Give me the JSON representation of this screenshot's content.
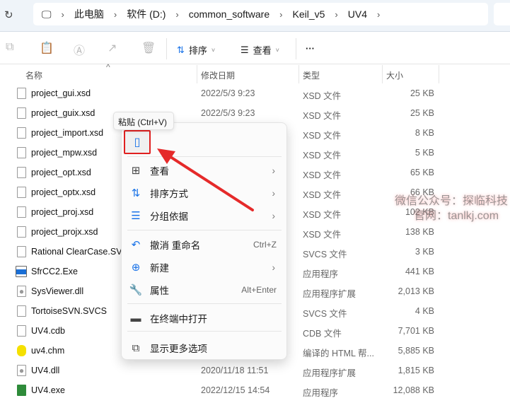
{
  "address": {
    "crumbs": [
      "此电脑",
      "软件 (D:)",
      "common_software",
      "Keil_v5",
      "UV4"
    ]
  },
  "toolbar": {
    "sort": "排序",
    "view": "查看",
    "more": "···"
  },
  "columns": [
    "名称",
    "修改日期",
    "类型",
    "大小"
  ],
  "files": [
    {
      "name": "project_gui.xsd",
      "date": "2022/5/3 9:23",
      "type": "XSD 文件",
      "size": "25 KB",
      "icon": "file"
    },
    {
      "name": "project_guix.xsd",
      "date": "2022/5/3 9:23",
      "type": "XSD 文件",
      "size": "25 KB",
      "icon": "file"
    },
    {
      "name": "project_import.xsd",
      "date": "",
      "type": "XSD 文件",
      "size": "8 KB",
      "icon": "file"
    },
    {
      "name": "project_mpw.xsd",
      "date": "",
      "type": "XSD 文件",
      "size": "5 KB",
      "icon": "file"
    },
    {
      "name": "project_opt.xsd",
      "date": "",
      "type": "XSD 文件",
      "size": "65 KB",
      "icon": "file"
    },
    {
      "name": "project_optx.xsd",
      "date": "",
      "type": "XSD 文件",
      "size": "66 KB",
      "icon": "file"
    },
    {
      "name": "project_proj.xsd",
      "date": "",
      "type": "XSD 文件",
      "size": "102 KB",
      "icon": "file"
    },
    {
      "name": "project_projx.xsd",
      "date": "",
      "type": "XSD 文件",
      "size": "138 KB",
      "icon": "file"
    },
    {
      "name": "Rational ClearCase.SV",
      "date": "",
      "type": "SVCS 文件",
      "size": "3 KB",
      "icon": "file"
    },
    {
      "name": "SfrCC2.Exe",
      "date": "",
      "type": "应用程序",
      "size": "441 KB",
      "icon": "exe"
    },
    {
      "name": "SysViewer.dll",
      "date": "",
      "type": "应用程序扩展",
      "size": "2,013 KB",
      "icon": "dll"
    },
    {
      "name": "TortoiseSVN.SVCS",
      "date": "",
      "type": "SVCS 文件",
      "size": "4 KB",
      "icon": "file"
    },
    {
      "name": "UV4.cdb",
      "date": "",
      "type": "CDB 文件",
      "size": "7,701 KB",
      "icon": "file"
    },
    {
      "name": "uv4.chm",
      "date": "",
      "type": "编译的 HTML 帮...",
      "size": "5,885 KB",
      "icon": "chm"
    },
    {
      "name": "UV4.dll",
      "date": "2020/11/18 11:51",
      "type": "应用程序扩展",
      "size": "1,815 KB",
      "icon": "dll"
    },
    {
      "name": "UV4.exe",
      "date": "2022/12/15 14:54",
      "type": "应用程序",
      "size": "12,088 KB",
      "icon": "uv"
    }
  ],
  "tooltip": "粘贴 (Ctrl+V)",
  "menu": [
    {
      "label": "查看",
      "icon": "grid-icon",
      "glyph": "⊞",
      "submenu": true
    },
    {
      "label": "排序方式",
      "icon": "sort-icon",
      "glyph": "⇅",
      "submenu": true
    },
    {
      "label": "分组依据",
      "icon": "group-icon",
      "glyph": "☰",
      "submenu": true
    },
    {
      "label": "撤消 重命名",
      "icon": "undo-icon",
      "glyph": "↶",
      "shortcut": "Ctrl+Z"
    },
    {
      "label": "新建",
      "icon": "plus-circle-icon",
      "glyph": "⊕",
      "submenu": true
    },
    {
      "label": "属性",
      "icon": "wrench-icon",
      "glyph": "🔧",
      "shortcut": "Alt+Enter"
    },
    {
      "label": "在终端中打开",
      "icon": "terminal-icon",
      "glyph": "▬"
    },
    {
      "label": "显示更多选项",
      "icon": "more-options-icon",
      "glyph": "⧉"
    }
  ],
  "watermark": {
    "line1": "微信公众号：探临科技",
    "line2": "官网：tanlkj.com"
  },
  "colors": {
    "accent": "#1a73e8",
    "highlight": "#e02020"
  }
}
